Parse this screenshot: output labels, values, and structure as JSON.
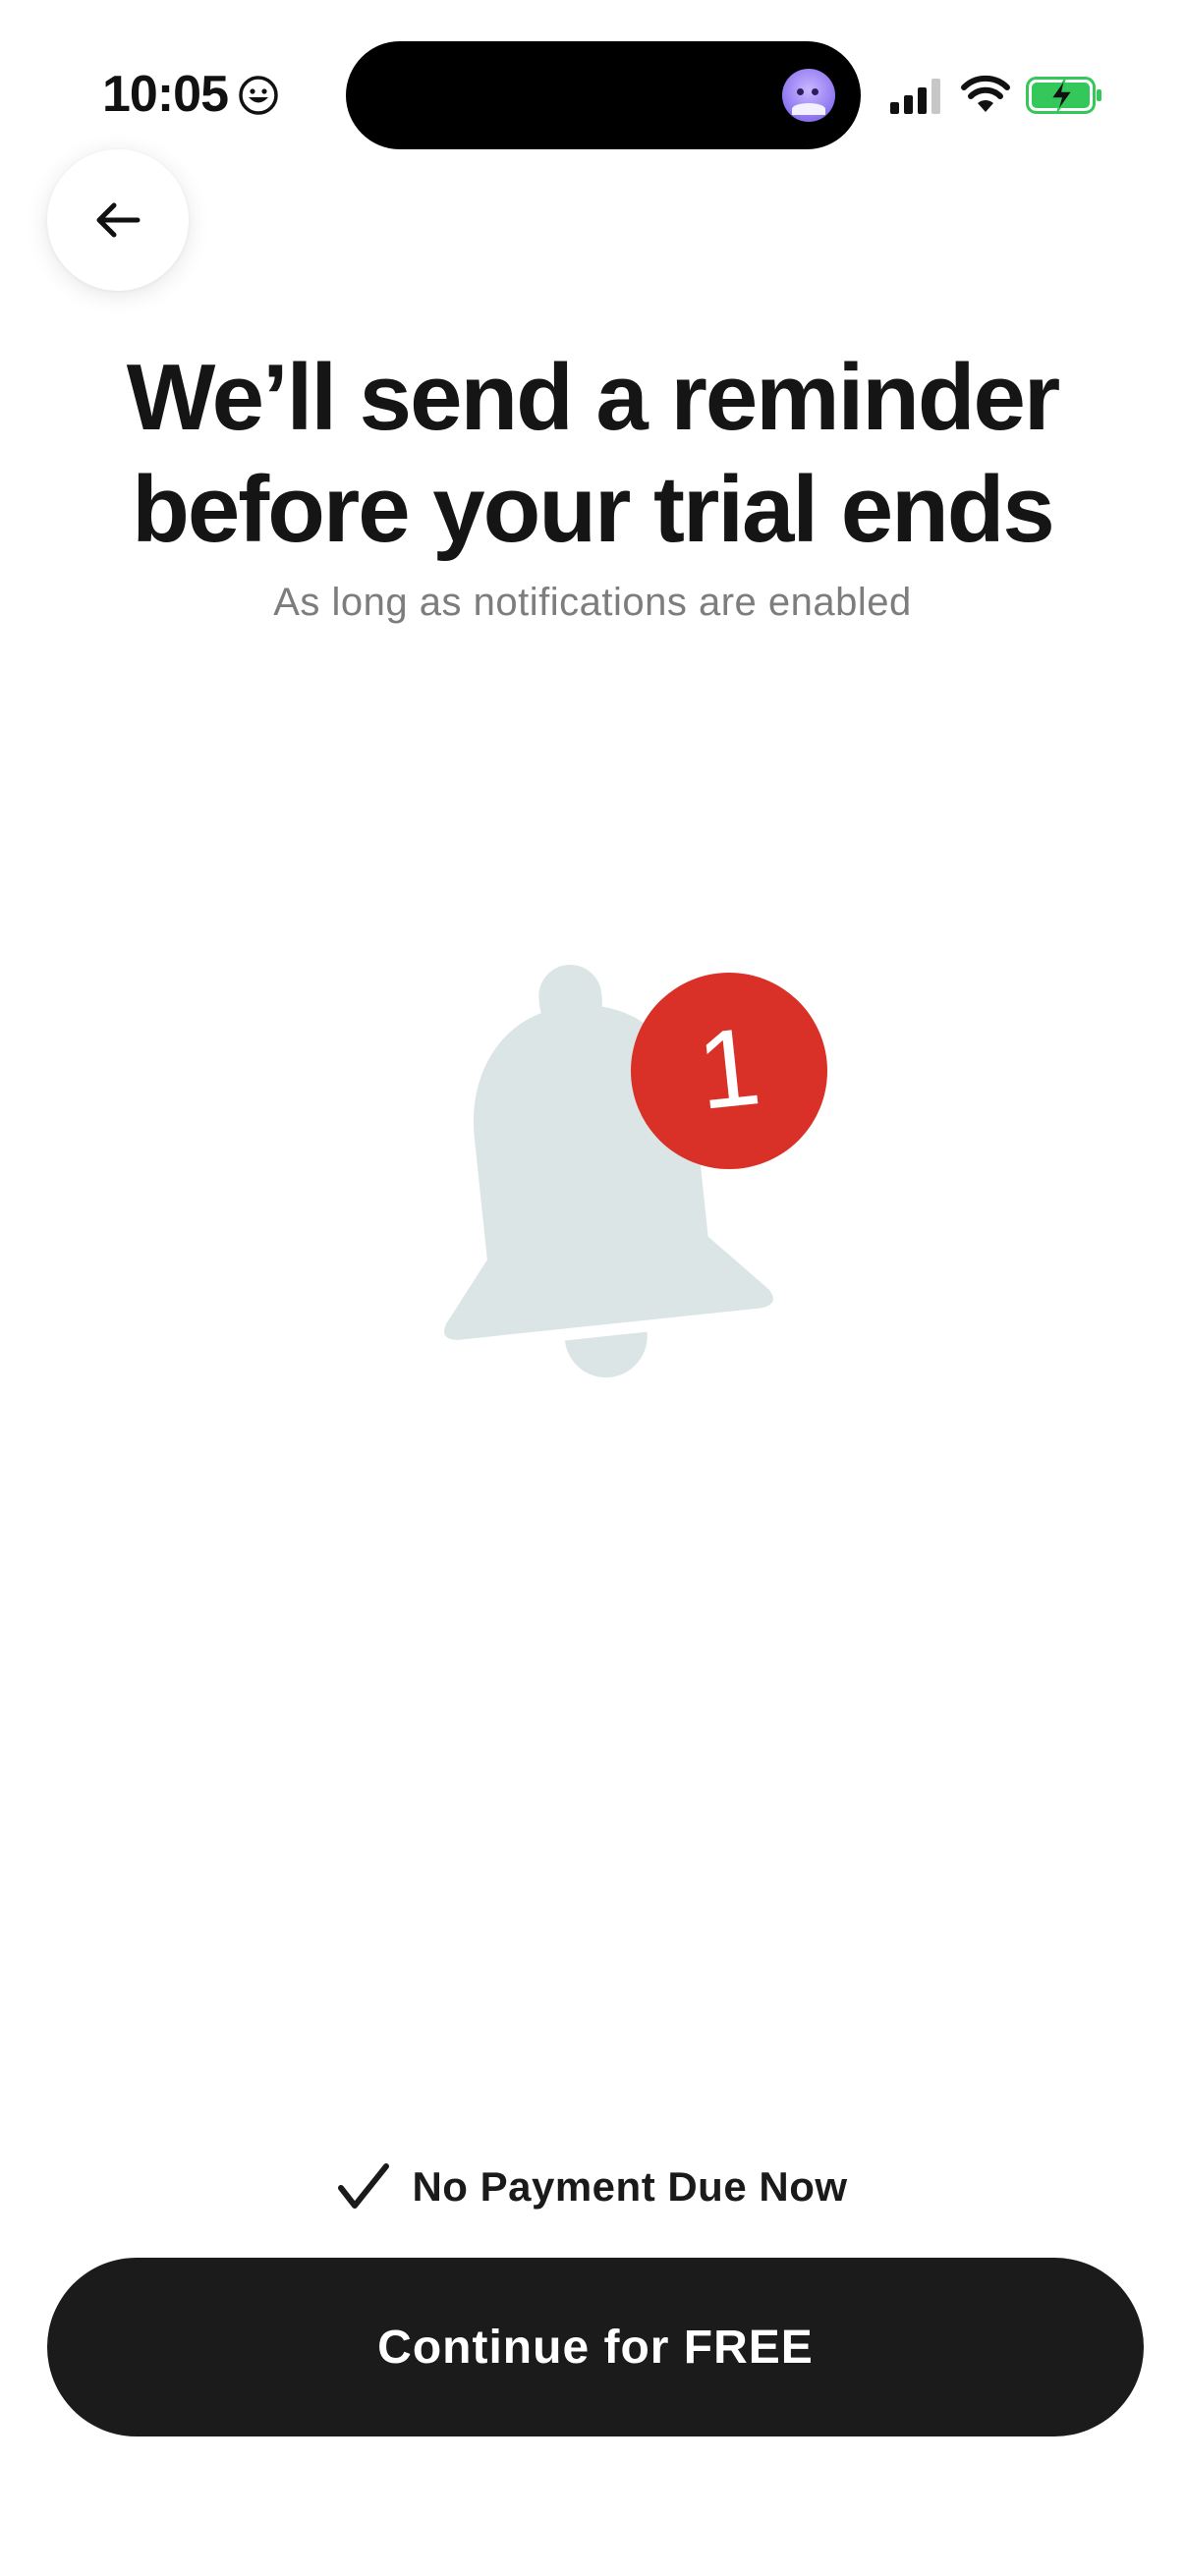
{
  "status_bar": {
    "time": "10:05",
    "icons": [
      "smiley-icon",
      "avatar-icon",
      "signal-icon",
      "wifi-icon",
      "battery-charging-icon"
    ],
    "battery_color": "#34c759"
  },
  "nav": {
    "back_icon": "arrow-left-icon"
  },
  "header": {
    "title": "We’ll send a reminder before your trial ends",
    "subtitle": "As long as notifications are enabled"
  },
  "illustration": {
    "icon": "bell-icon",
    "badge_count": "1",
    "bell_color": "#dbe5e5",
    "badge_color": "#d93127"
  },
  "footer": {
    "note_icon": "checkmark-icon",
    "note": "No Payment Due Now",
    "cta_label": "Continue for FREE",
    "cta_color": "#1b1b1b"
  }
}
